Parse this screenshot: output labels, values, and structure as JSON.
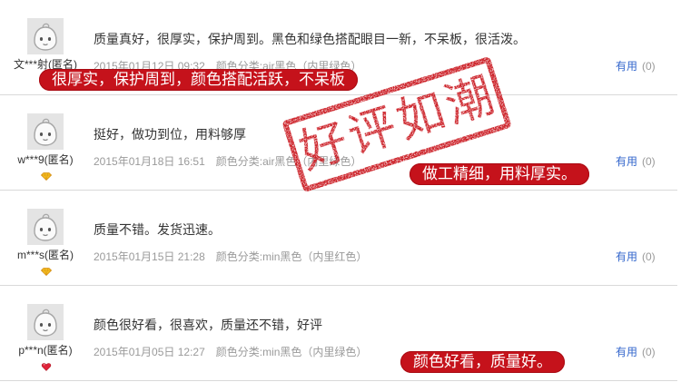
{
  "reviews": [
    {
      "avatar_icon": "default-avatar-icon",
      "username": "文***射(匿名)",
      "content": "质量真好，很厚实，保护周到。黑色和绿色搭配眼目一新，不呆板，很活泼。",
      "date": "2015年01月12日 09:32",
      "sku": "颜色分类:air黑色（内里绿色）",
      "helpful_label": "有用",
      "helpful_count": "(0)"
    },
    {
      "avatar_icon": "default-avatar-icon",
      "username": "w***9(匿名)",
      "badge_icon": "gold-diamond-icon",
      "content": "挺好，做功到位，用料够厚",
      "date": "2015年01月18日 16:51",
      "sku": "颜色分类:air黑色（内里绿色）",
      "helpful_label": "有用",
      "helpful_count": "(0)"
    },
    {
      "avatar_icon": "default-avatar-icon",
      "username": "m***s(匿名)",
      "badge_icon": "gold-diamond-icon",
      "content": "质量不错。发货迅速。",
      "date": "2015年01月15日 21:28",
      "sku": "颜色分类:min黑色（内里红色）",
      "helpful_label": "有用",
      "helpful_count": "(0)"
    },
    {
      "avatar_icon": "default-avatar-icon",
      "username": "p***n(匿名)",
      "badge_icon": "red-heart-icon",
      "content": "颜色很好看，很喜欢，质量还不错，好评",
      "date": "2015年01月05日 12:27",
      "sku": "颜色分类:min黑色（内里绿色）",
      "helpful_label": "有用",
      "helpful_count": "(0)"
    }
  ],
  "highlights": [
    "很厚实，保护周到，颜色搭配活跃，不呆板",
    "做工精细，用料厚实。",
    "颜色好看，质量好。"
  ],
  "stamp": {
    "text": "好评如潮"
  },
  "colors": {
    "stamp_red": "#c9141c",
    "highlight_red": "#c5121b",
    "link_blue": "#3366cc",
    "text_dark": "#333333",
    "meta_gray": "#999999",
    "badge_gold": "#f5bf1f",
    "badge_heart": "#e0243a"
  }
}
